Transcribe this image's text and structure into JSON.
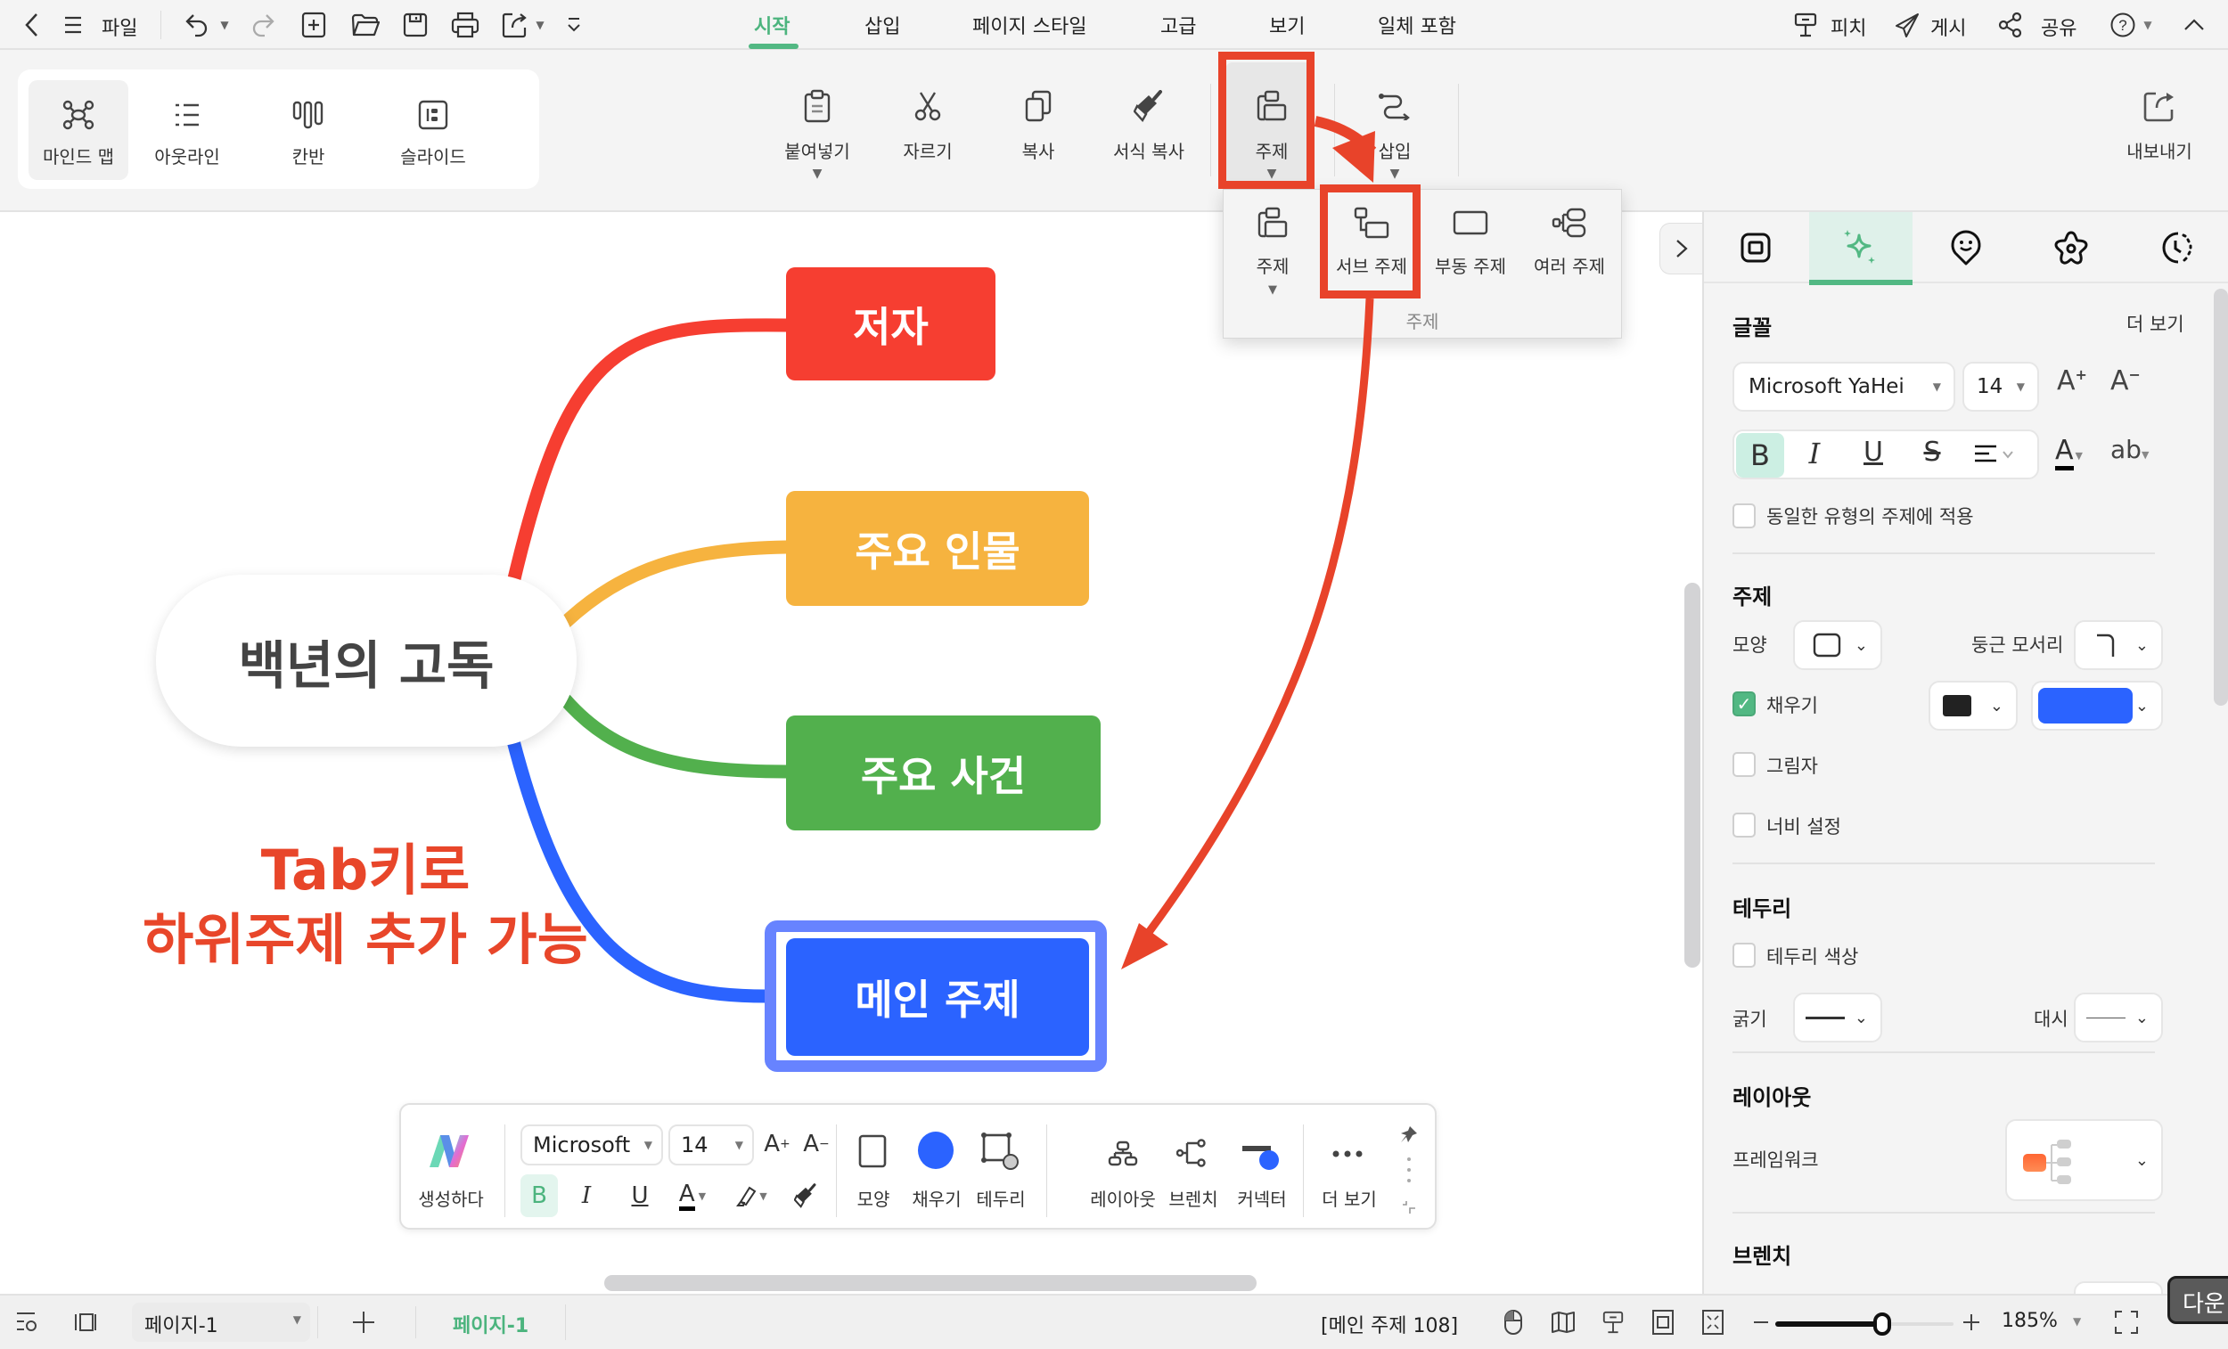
{
  "topbar": {
    "file_label": "파일",
    "icons": [
      "back-icon",
      "hamburger-menu-icon",
      "undo-icon",
      "redo-icon",
      "new-file-icon",
      "open-folder-icon",
      "save-icon",
      "print-icon",
      "export-share-icon",
      "quick-access-more-icon"
    ],
    "menu_tabs": [
      {
        "label": "시작",
        "active": true
      },
      {
        "label": "삽입",
        "active": false
      },
      {
        "label": "페이지 스타일",
        "active": false
      },
      {
        "label": "고급",
        "active": false
      },
      {
        "label": "보기",
        "active": false
      },
      {
        "label": "일체 포함",
        "active": false
      }
    ],
    "right_actions": [
      {
        "label": "피치",
        "icon": "presentation-icon"
      },
      {
        "label": "게시",
        "icon": "send-icon"
      },
      {
        "label": "공유",
        "icon": "share-icon"
      }
    ],
    "help_icon": "help-icon",
    "collapse_icon": "chevron-up-icon"
  },
  "ribbon": {
    "views": [
      {
        "label": "마인드 맵",
        "icon": "mindmap-icon",
        "active": true
      },
      {
        "label": "아웃라인",
        "icon": "outline-icon",
        "active": false
      },
      {
        "label": "칸반",
        "icon": "kanban-icon",
        "active": false
      },
      {
        "label": "슬라이드",
        "icon": "slide-icon",
        "active": false
      }
    ],
    "tools": [
      {
        "label": "붙여넣기",
        "icon": "clipboard-icon",
        "has_caret": true
      },
      {
        "label": "자르기",
        "icon": "scissors-icon",
        "has_caret": false
      },
      {
        "label": "복사",
        "icon": "copy-icon",
        "has_caret": false
      },
      {
        "label": "서식 복사",
        "icon": "format-painter-icon",
        "has_caret": false
      },
      {
        "label": "주제",
        "icon": "topic-icon",
        "has_caret": true
      },
      {
        "label": "삽입",
        "icon": "connector-insert-icon",
        "has_caret": true
      }
    ],
    "export_label": "내보내기"
  },
  "topic_popup": {
    "items": [
      {
        "label": "주제",
        "icon": "topic-icon"
      },
      {
        "label": "서브 주제",
        "icon": "subtopic-icon"
      },
      {
        "label": "부동 주제",
        "icon": "floating-topic-icon"
      },
      {
        "label": "여러 주제",
        "icon": "multiple-topics-icon"
      }
    ],
    "group_label": "주제"
  },
  "mindmap": {
    "root": "백년의 고독",
    "children": [
      {
        "label": "저자",
        "color": "#f63e31"
      },
      {
        "label": "주요 인물",
        "color": "#f6b33f"
      },
      {
        "label": "주요 사건",
        "color": "#52b04d"
      },
      {
        "label": "메인 주제",
        "color": "#2b63ff",
        "selected": true
      }
    ],
    "annotation_line1": "Tab키로",
    "annotation_line2": "하위주제 추가 가능"
  },
  "float_toolbar": {
    "ai_label": "생성하다",
    "font_name": "Microsoft",
    "font_size": "14",
    "shape_label": "모양",
    "fill_label": "채우기",
    "border_label": "테두리",
    "layout_label": "레이아웃",
    "branch_label": "브렌치",
    "connector_label": "커넥터",
    "more_label": "더 보기",
    "fill_color": "#2b63ff"
  },
  "panel": {
    "tabs": [
      "style-tab-icon",
      "ai-sparkle-icon",
      "marker-icon",
      "theme-flower-icon",
      "history-clock-icon"
    ],
    "font_section": {
      "title": "글꼴",
      "more": "더 보기",
      "font_name": "Microsoft YaHei",
      "font_size": "14",
      "apply_same_label": "동일한 유형의 주제에 적용",
      "apply_same_checked": false
    },
    "topic_section": {
      "title": "주제",
      "shape_label": "모양",
      "corner_label": "둥근 모서리",
      "fill_label": "채우기",
      "fill_checked": true,
      "fill_color": "#2b63ff",
      "text_color": "#222222",
      "shadow_label": "그림자",
      "shadow_checked": false,
      "width_label": "너비 설정",
      "width_checked": false
    },
    "border_section": {
      "title": "테두리",
      "color_label": "테두리 색상",
      "color_checked": false,
      "weight_label": "굵기",
      "dash_label": "대시"
    },
    "layout_section": {
      "title": "레이아웃",
      "framework_label": "프레임워크"
    },
    "branch_section": {
      "title": "브렌치"
    }
  },
  "statusbar": {
    "page_select": "페이지-1",
    "page_tab": "페이지-1",
    "selection_info": "[메인 주제 108]",
    "zoom_level": "185%",
    "zoom_fraction": 0.6
  },
  "tooltip": {
    "text": "다운"
  }
}
